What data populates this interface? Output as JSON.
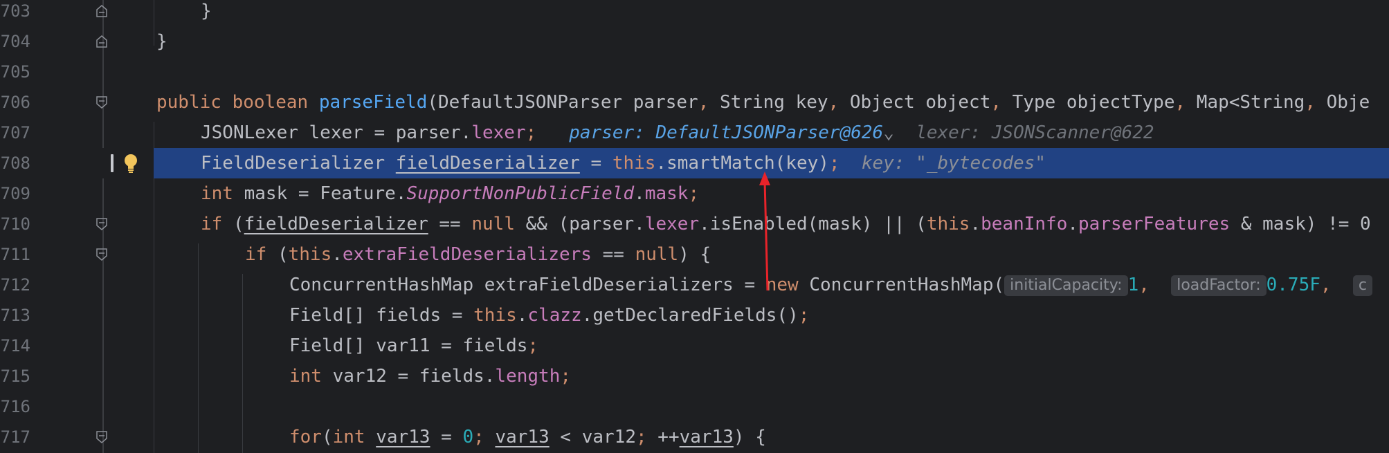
{
  "editor": {
    "lines": [
      {
        "num": "703",
        "closing": "}"
      },
      {
        "num": "704",
        "closing": "}"
      },
      {
        "num": "705"
      },
      {
        "num": "706",
        "public": "public",
        "boolean": "boolean",
        "method": "parseField",
        "p1": "(DefaultJSONParser parser",
        "c1": ",",
        "p2": " String key",
        "c2": ",",
        "p3": " Object object",
        "c3": ",",
        "p4": " Type objectType",
        "c4": ",",
        "p5": " Map<String",
        "c5": ",",
        "p6": " Obje"
      },
      {
        "num": "707",
        "type": "JSONLexer lexer = parser.",
        "field": "lexer",
        "semi": ";",
        "hint1_name": "parser:",
        "hint1_val": "DefaultJSONParser@626",
        "chevron": "⌄",
        "hint2_name": "lexer:",
        "hint2_val": "JSONScanner@622"
      },
      {
        "num": "708",
        "type": "FieldDeserializer ",
        "var": "fieldDeserializer",
        "eq": " = ",
        "this": "this",
        "call": ".smartMatch(key)",
        "semi": ";",
        "hint_name": "key:",
        "hint_val": "\"_bytecodes\""
      },
      {
        "num": "709",
        "int": "int",
        "pre": " mask = Feature.",
        "static": "SupportNonPublicField",
        "dot": ".",
        "field": "mask",
        "semi": ";"
      },
      {
        "num": "710",
        "if": "if",
        "open": " (",
        "var": "fieldDeserializer",
        "eqnull": " == ",
        "null": "null",
        "mid": " && (parser.",
        "lexer": "lexer",
        "call": ".isEnabled(mask) || (",
        "this": "this",
        "dot1": ".",
        "beanInfo": "beanInfo",
        "dot2": ".",
        "pf": "parserFeatures",
        "tail": " & mask) != 0"
      },
      {
        "num": "711",
        "if": "if",
        "open": " (",
        "this": "this",
        "dot": ".",
        "field": "extraFieldDeserializers",
        "eq": " == ",
        "null": "null",
        "tail": ") {"
      },
      {
        "num": "712",
        "pre": "ConcurrentHashMap extraFieldDeserializers = ",
        "new": "new",
        "ctor": " ConcurrentHashMap(",
        "hint1": "initialCapacity:",
        "v1": "1",
        "c1": ", ",
        "hint2": "loadFactor:",
        "v2": "0.75F",
        "c2": ", ",
        "hint3": "c"
      },
      {
        "num": "713",
        "pre": "Field[] fields = ",
        "this": "this",
        "dot": ".",
        "field": "clazz",
        "call": ".getDeclaredFields()",
        "semi": ";"
      },
      {
        "num": "714",
        "pre": "Field[] var11 = fields",
        "semi": ";"
      },
      {
        "num": "715",
        "int": "int",
        "pre": " var12 = fields.",
        "field": "length",
        "semi": ";"
      },
      {
        "num": "716"
      },
      {
        "num": "717",
        "for": "for",
        "p1": "(",
        "int": "int",
        "sp": " ",
        "v1": "var13",
        "eq": " = ",
        "zero": "0",
        "s1": ";",
        "sp2": " ",
        "v2": "var13",
        "lt": " < var12",
        "s2": ";",
        "inc": " ++",
        "v3": "var13",
        "tail": ") {"
      }
    ]
  },
  "icons": {
    "fold_marker": "fold-icon",
    "intention_bulb": "lightbulb-icon",
    "annotation_arrow": "red-arrow"
  },
  "colors": {
    "background": "#1e1f22",
    "current_line": "#214283",
    "keyword": "#cf8e6d",
    "method": "#56a8f5",
    "field": "#c77dbb",
    "number": "#2aacb8",
    "arrow": "#e8232a"
  }
}
